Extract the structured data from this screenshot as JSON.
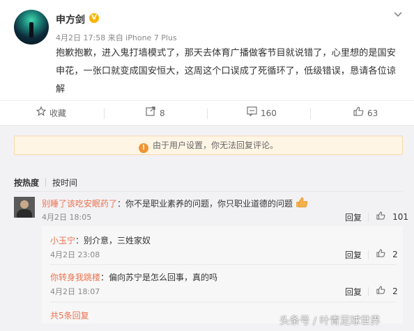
{
  "post": {
    "author": "申方剑",
    "verified_badge": "V",
    "meta": "4月2日 17:58 来自 iPhone 7 Plus",
    "menu_icon": "chevron-down-icon",
    "text": "抱歉抱歉，进入鬼打墙模式了，那天去体育广播做客节目就说错了，心里想的是国安申花，一张口就变成国安恒大，这周这个口误成了死循环了，低级错误，恳请各位谅解"
  },
  "actions": {
    "favorite_label": "收藏",
    "repost_count": "8",
    "comment_count": "160",
    "like_count": "63"
  },
  "notice": "由于用户设置，你无法回复评论。",
  "sort": {
    "by_hot": "按热度",
    "by_time": "按时间"
  },
  "comment": {
    "username": "别睡了该吃安眠药了",
    "text": "：你不是职业素养的问题，你只职业道德的问题",
    "time": "4月2日 18:05",
    "reply_label": "回复",
    "likes": "101"
  },
  "replies": [
    {
      "username": "小玉宁",
      "text": "：别介意，三姓家奴",
      "time": "4月2日 23:08",
      "reply_label": "回复",
      "likes": "2"
    },
    {
      "username": "你转身我跳楼",
      "text": "：偏向苏宁是怎么回事，真的吗",
      "time": "4月2日 18:07",
      "reply_label": "回复",
      "likes": "2"
    }
  ],
  "more_replies": "共5条回复",
  "watermark": "头条号 / 叶青足球世界",
  "colors": {
    "accent": "#eb7350",
    "notice_bg": "#fff5e5",
    "notice_icon": "#f19333",
    "verified": "#f7b500"
  }
}
